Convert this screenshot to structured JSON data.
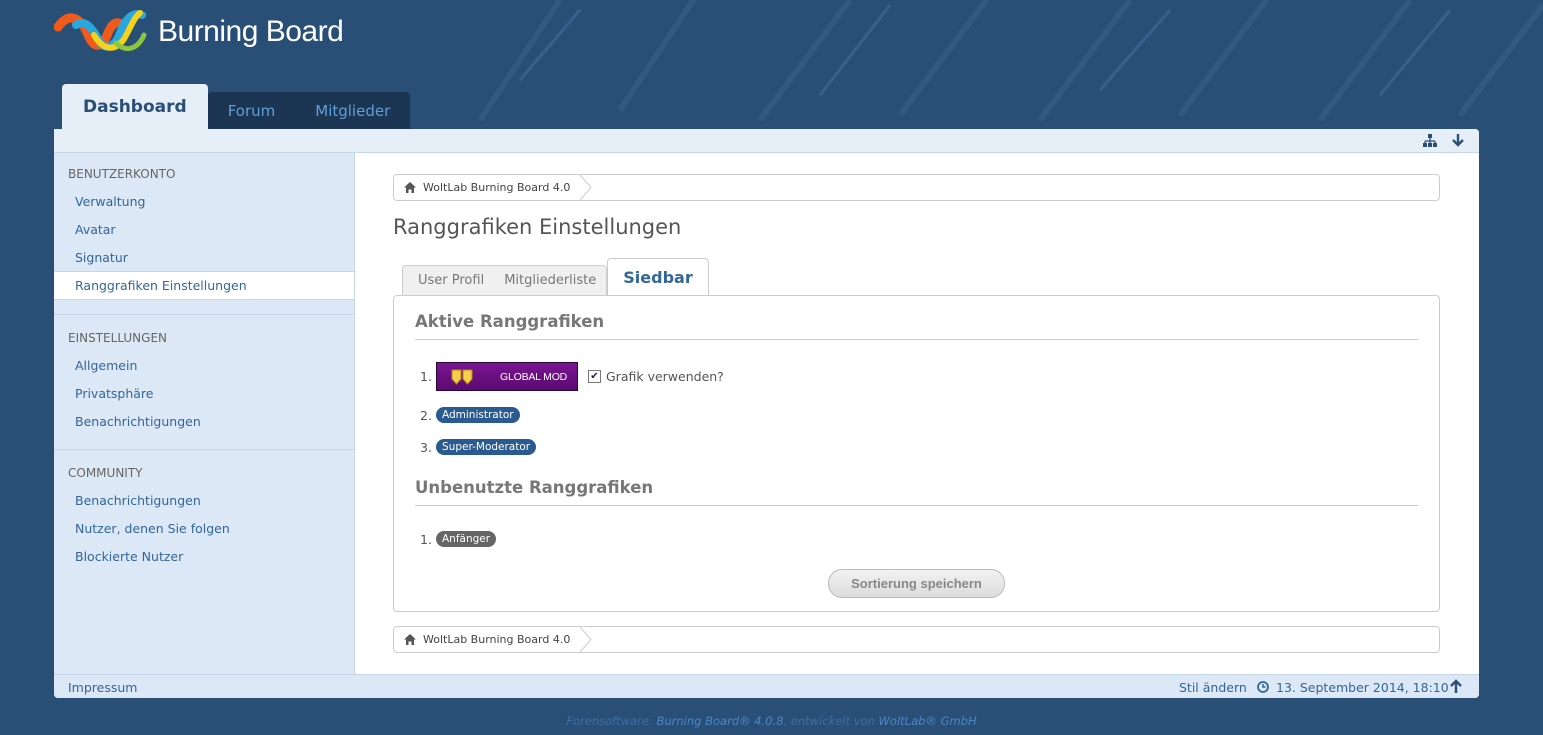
{
  "brand": {
    "logo_text": "Burning Board"
  },
  "main_nav": {
    "tabs": [
      {
        "label": "Dashboard",
        "active": true
      },
      {
        "label": "Forum",
        "active": false
      },
      {
        "label": "Mitglieder",
        "active": false
      }
    ]
  },
  "topbar_icons": [
    "sitemap-icon",
    "arrow-down-icon"
  ],
  "sidebar": {
    "sections": [
      {
        "heading": "BENUTZERKONTO",
        "items": [
          {
            "label": "Verwaltung"
          },
          {
            "label": "Avatar"
          },
          {
            "label": "Signatur"
          },
          {
            "label": "Ranggrafiken Einstellungen",
            "active": true
          }
        ]
      },
      {
        "heading": "EINSTELLUNGEN",
        "items": [
          {
            "label": "Allgemein"
          },
          {
            "label": "Privatsphäre"
          },
          {
            "label": "Benachrichtigungen"
          }
        ]
      },
      {
        "heading": "COMMUNITY",
        "items": [
          {
            "label": "Benachrichtigungen"
          },
          {
            "label": "Nutzer, denen Sie folgen"
          },
          {
            "label": "Blockierte Nutzer"
          }
        ]
      }
    ]
  },
  "breadcrumb": {
    "label": "WoltLab Burning Board 4.0"
  },
  "page": {
    "title": "Ranggrafiken Einstellungen"
  },
  "tabs": [
    {
      "label": "User Profil"
    },
    {
      "label": "Mitgliederliste"
    },
    {
      "label": "Siedbar",
      "active": true
    }
  ],
  "active_section": {
    "title": "Aktive Ranggrafiken",
    "items": [
      {
        "num": "1.",
        "rank_image_text": "GLOBAL MOD",
        "checkbox_checked": true,
        "checkbox_label": "Grafik verwenden?"
      },
      {
        "num": "2.",
        "badge": "Administrator"
      },
      {
        "num": "3.",
        "badge": "Super-Moderator"
      }
    ]
  },
  "unused_section": {
    "title": "Unbenutzte Ranggrafiken",
    "items": [
      {
        "num": "1.",
        "badge": "Anfänger"
      }
    ]
  },
  "save_button": {
    "label": "Sortierung speichern"
  },
  "footer": {
    "impressum": "Impressum",
    "style_change": "Stil ändern",
    "datetime": "13. September 2014, 18:10"
  },
  "copyright": {
    "prefix": "Forensoftware: ",
    "product": "Burning Board® 4.0.8",
    "middle": ", entwickelt von ",
    "company": "WoltLab® GmbH"
  },
  "colors": {
    "background": "#2a4f77",
    "link": "#336699",
    "sidebar_bg": "#dce8f5",
    "badge_blue": "#2a5a8f",
    "badge_grey": "#666666",
    "rank_purple": "#6a0f83"
  }
}
